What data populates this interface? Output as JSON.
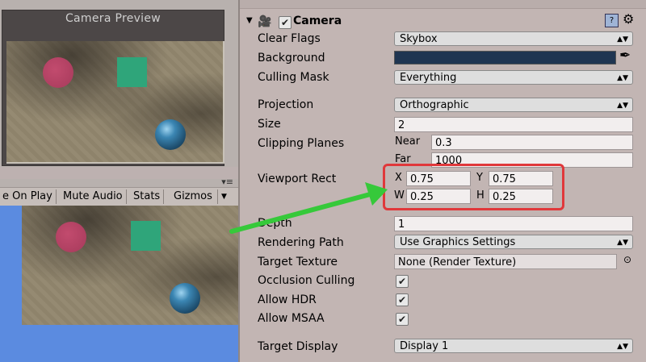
{
  "preview": {
    "title": "Camera Preview"
  },
  "game_toolbar": {
    "items": [
      {
        "label": "e On Play"
      },
      {
        "label": "Mute Audio"
      },
      {
        "label": "Stats"
      },
      {
        "label": "Gizmos"
      }
    ],
    "menu_icon": "menu-icon"
  },
  "component": {
    "title": "Camera",
    "enabled": true
  },
  "camera": {
    "clear_flags": {
      "label": "Clear Flags",
      "value": "Skybox"
    },
    "background": {
      "label": "Background",
      "color": "#1f3551"
    },
    "culling_mask": {
      "label": "Culling Mask",
      "value": "Everything"
    },
    "projection": {
      "label": "Projection",
      "value": "Orthographic"
    },
    "size": {
      "label": "Size",
      "value": "2"
    },
    "clipping": {
      "label": "Clipping Planes",
      "near_label": "Near",
      "near": "0.3",
      "far_label": "Far",
      "far": "1000"
    },
    "viewport": {
      "label": "Viewport Rect",
      "x_label": "X",
      "x": "0.75",
      "y_label": "Y",
      "y": "0.75",
      "w_label": "W",
      "w": "0.25",
      "h_label": "H",
      "h": "0.25"
    },
    "depth": {
      "label": "Depth",
      "value": "1"
    },
    "rendering_path": {
      "label": "Rendering Path",
      "value": "Use Graphics Settings"
    },
    "target_texture": {
      "label": "Target Texture",
      "value": "None (Render Texture)"
    },
    "occlusion_culling": {
      "label": "Occlusion Culling",
      "checked": true
    },
    "allow_hdr": {
      "label": "Allow HDR",
      "checked": true
    },
    "allow_msaa": {
      "label": "Allow MSAA",
      "checked": true
    },
    "target_display": {
      "label": "Target Display",
      "value": "Display 1"
    }
  },
  "colors": {
    "highlight": "#e0383b",
    "arrow": "#36c93a",
    "game_view_bg": "#5b8be0"
  }
}
